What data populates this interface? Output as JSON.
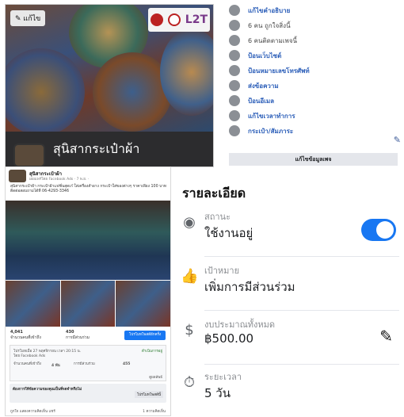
{
  "cover": {
    "edit_label": "แก้ไข",
    "page_name": "สุนิสากระเป๋าผ้า",
    "logo_text": "L2T"
  },
  "info": {
    "items": [
      {
        "icon": "info-icon",
        "text": "แก้ไขคำอธิบาย"
      },
      {
        "icon": "thumbs-up-icon",
        "text": "6 คน ถูกใจสิ่งนี้"
      },
      {
        "icon": "check-icon",
        "text": "6 คนติดตามเพจนี้"
      },
      {
        "icon": "globe-icon",
        "text": "ป้อนเว็บไซต์"
      },
      {
        "icon": "phone-icon",
        "text": "ป้อนหมายเลขโทรศัพท์"
      },
      {
        "icon": "messenger-icon",
        "text": "ส่งข้อความ"
      },
      {
        "icon": "email-icon",
        "text": "ป้อนอีเมล"
      },
      {
        "icon": "clock-icon",
        "text": "แก้ไขเวลาทำการ"
      },
      {
        "icon": "folder-icon",
        "text": "กระเป๋า/สัมภาระ"
      }
    ],
    "edit_page_info": "แก้ไขข้อมูลเพจ"
  },
  "post": {
    "author": "สุนิสากระเป๋าผ้า",
    "sub": "เผยแพร่โดย Facebook Ads · 7 พ.ย. ·",
    "body": "สุนิสากระเป๋าผ้า กระเป๋าผ้าแฟชั่นสุดเก๋ ใส่เครื่องสำอาง กระเป๋าใส่ของต่างๆ ราคาเพียง 100 บาท ติดต่อสอบถามได้ที่ 06-4293-3346",
    "likes": "4,041",
    "likes_label": "จำนวนคนที่เข้าถึง",
    "engagements": "430",
    "engagements_label": "การมีส่วนร่วม",
    "boost_label": "โปรโมทโพสต์อีกครั้ง",
    "ad_status": "โปรโมทเมื่อ 27 พฤศจิกายน เวลา 20:15 น.",
    "ad_status_badge": "ดำเนินการอยู่",
    "ad_by": "โดย Facebook Ads",
    "ad_reach_label": "จำนวนคนที่เข้าถึง",
    "ad_reach": "4 พัน",
    "ad_engage_label": "การมีส่วนร่วม",
    "ad_engage": "455",
    "ad_see_more": "ดูผลลัพธ์",
    "tip_title": "ต้องการให้ข้อความของคุณเป็นที่จดจำหรือไม่",
    "tip_btn": "โปรโมทโพสต์นี้",
    "like_row": "ถูกใจ แสดงความคิดเห็น แชร์",
    "comments": "1 ความคิดเห็น"
  },
  "details": {
    "title": "รายละเอียด",
    "rows": [
      {
        "icon": "status-icon",
        "label": "สถานะ",
        "value": "ใช้งานอยู่",
        "control": "toggle"
      },
      {
        "icon": "thumbs-up-icon",
        "label": "เป้าหมาย",
        "value": "เพิ่มการมีส่วนร่วม",
        "control": "none"
      },
      {
        "icon": "dollar-icon",
        "label": "งบประมาณทั้งหมด",
        "value": "฿500.00",
        "control": "pencil"
      },
      {
        "icon": "timer-icon",
        "label": "ระยะเวลา",
        "value": "5 วัน",
        "control": "none"
      }
    ]
  },
  "colors": {
    "accent": "#1877f2",
    "link": "#2a5db8"
  }
}
